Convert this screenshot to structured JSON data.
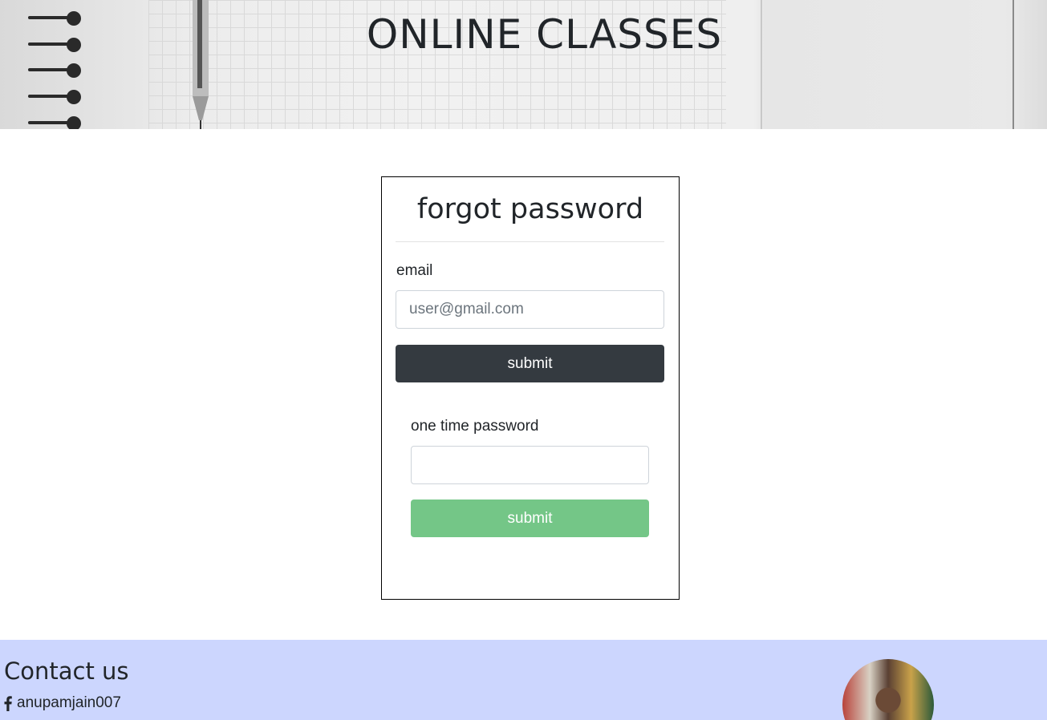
{
  "header": {
    "title": "ONLINE CLASSES"
  },
  "card": {
    "title": "forgot password",
    "email_label": "email",
    "email_placeholder": "user@gmail.com",
    "email_submit_label": "submit",
    "otp_label": "one time password",
    "otp_value": "",
    "otp_submit_label": "submit"
  },
  "footer": {
    "contact_title": "Contact us",
    "facebook_handle": "anupamjain007",
    "facebook_icon": "facebook-icon"
  },
  "colors": {
    "dark_button": "#343a40",
    "green_button": "#74c687",
    "footer_bg": "#ccd6fe"
  }
}
